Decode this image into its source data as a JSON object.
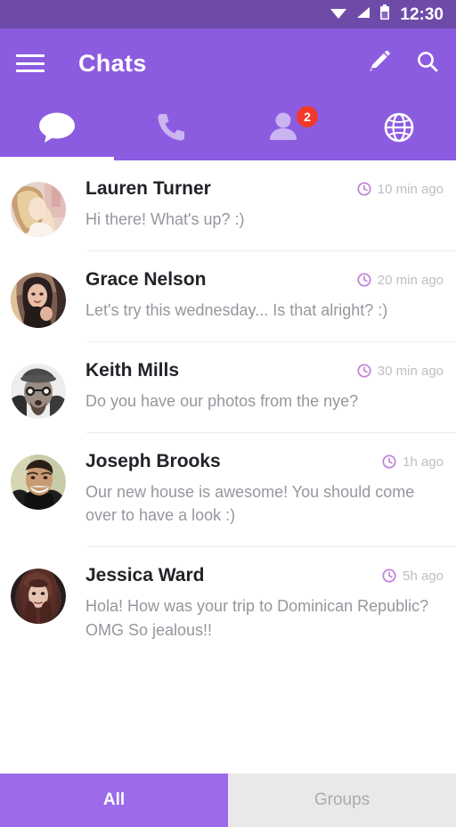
{
  "status_bar": {
    "time": "12:30",
    "icons": [
      "wifi-icon",
      "cellular-signal-icon",
      "battery-icon"
    ]
  },
  "appbar": {
    "menu_icon": "hamburger-menu-icon",
    "title": "Chats",
    "actions": [
      {
        "icon": "pencil-compose-icon",
        "name": "compose"
      },
      {
        "icon": "search-icon",
        "name": "search"
      }
    ]
  },
  "tabs": [
    {
      "name": "chats",
      "icon": "chat-bubble-icon",
      "active": true,
      "badge": ""
    },
    {
      "name": "calls",
      "icon": "phone-icon",
      "active": false,
      "badge": ""
    },
    {
      "name": "contacts",
      "icon": "person-icon",
      "active": false,
      "badge": "2"
    },
    {
      "name": "public",
      "icon": "globe-icon",
      "active": false,
      "badge": ""
    }
  ],
  "colors": {
    "status_bar": "#6E4BA9",
    "appbar": "#8C5CE0",
    "accent": "#9B6BEB",
    "badge": "#F0392B",
    "clock_icon": "#C07FD8",
    "name_text": "#222228",
    "message_text": "#96969E",
    "time_text": "#BDBDC4",
    "divider": "#ECECEE",
    "inactive_tab_bg": "#E9E9E9",
    "inactive_tab_text": "#ABABAB"
  },
  "chats": [
    {
      "name": "Lauren Turner",
      "message": "Hi there! What's up? :)",
      "time": "10 min ago",
      "avatar": "avatar-blonde-woman"
    },
    {
      "name": "Grace Nelson",
      "message": "Let's try this wednesday... Is that alright? :)",
      "time": "20 min ago",
      "avatar": "avatar-dark-hair-woman"
    },
    {
      "name": "Keith Mills",
      "message": "Do you have our photos from the nye?",
      "time": "30 min ago",
      "avatar": "avatar-man-glasses-hat"
    },
    {
      "name": "Joseph Brooks",
      "message": "Our new house is awesome! You should come over to have a look :)",
      "time": "1h ago",
      "avatar": "avatar-smiling-man"
    },
    {
      "name": "Jessica Ward",
      "message": "Hola! How was your trip to Dominican Republic? OMG So jealous!!",
      "time": "5h ago",
      "avatar": "avatar-red-hair-woman"
    }
  ],
  "bottom_tabs": [
    {
      "label": "All",
      "active": true
    },
    {
      "label": "Groups",
      "active": false
    }
  ]
}
